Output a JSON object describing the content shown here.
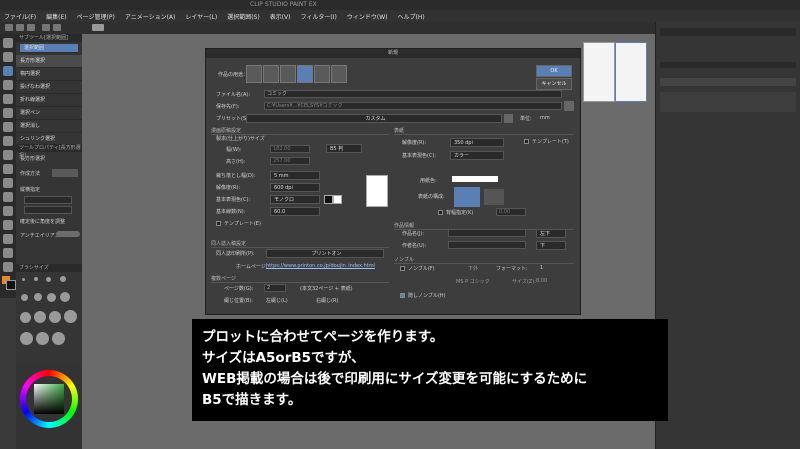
{
  "window": {
    "title": "CLIP STUDIO PAINT EX"
  },
  "menu": [
    "ファイル(F)",
    "編集(E)",
    "ページ管理(P)",
    "アニメーション(A)",
    "レイヤー(L)",
    "選択範囲(S)",
    "表示(V)",
    "フィルター(I)",
    "ウィンドウ(W)",
    "ヘルプ(H)"
  ],
  "subtool": {
    "header": "サブツール[選択範囲]",
    "selected_tab": "選択範囲",
    "items": [
      "長方形選択",
      "楕円選択",
      "投げなわ選択",
      "折れ線選択",
      "選択ペン",
      "選択消し",
      "シュリンク選択"
    ]
  },
  "props": {
    "header": "ツールプロパティ[長方形選択]",
    "label": "長方形選択",
    "mode": "作成方法",
    "fix": "縦横指定",
    "hint": "確定後に角度を調整",
    "aa": "アンチエイリアス"
  },
  "brush": {
    "header": "ブラシサイズ"
  },
  "dialog": {
    "title": "新規",
    "purpose_label": "作品の用途：",
    "ok": "OK",
    "cancel": "キャンセル",
    "filename_label": "ファイル名(A):",
    "filename_value": "コミック",
    "savepath_label": "保存先(F):",
    "savepath_value": "C:¥Users¥...¥CELSYS¥コミック",
    "preset_label": "プリセット(S):",
    "preset_value": "カスタム",
    "unit_label": "単位:",
    "unit_value": "mm",
    "manga_section": "漫画原稿設定",
    "finish_size": "製本(仕上がり)サイズ",
    "width_label": "幅(W):",
    "width_value": "182.00",
    "height_label": "高さ(H):",
    "height_value": "257.00",
    "size_value": "B5 判",
    "bleed_label": "裁ち落とし幅(D):",
    "bleed_value": "5 mm",
    "res_label": "解像度(R):",
    "res_value": "600 dpi",
    "color_label": "基本表現色(C):",
    "color_value": "モノクロ",
    "frame_label": "基本線数(N):",
    "frame_value": "60.0",
    "template_label": "テンプレート(E)",
    "doujin_section": "同人誌入稿設定",
    "doujin_label": "同人誌印刷所(P):",
    "doujin_value": "プリントオン",
    "homepage_label": "ホームページ:",
    "homepage_value": "https://www.printon.co.jp/doujin_index.html",
    "multipage_section": "複数ページ",
    "pages_label": "ページ数(G):",
    "pages_value": "2",
    "pages_note": "(本文32ページ + 表紙)",
    "binding_label": "綴じ位置(B):",
    "binding_left": "左綴じ(L)",
    "binding_right": "右綴じ(R)",
    "cover_section": "表紙",
    "cover_res_label": "解像度(R):",
    "cover_res_value": "350 dpi",
    "cover_color_label": "基本表現色(C):",
    "cover_color_value": "カラー",
    "cover_template": "テンプレート(T)",
    "paper_color_label": "用紙色:",
    "cover_layout_label": "表紙の構成:",
    "spine_label": "背幅指定(K)",
    "spine_value": "0.00",
    "info_section": "作品情報",
    "work_name_label": "作品名(J):",
    "work_name_pos": "左下",
    "author_label": "作者名(U):",
    "author_pos": "下",
    "nombre_section": "ノンブル",
    "nombre_label": "ノンブル(F)",
    "nombre_pos": "下外",
    "font_label": "フォーマット:",
    "start_value": "1",
    "font_value": "MS P ゴシック",
    "size_label": "サイズ(Z):",
    "size_num": "8.00",
    "hidden_nombre": "隠しノンブル(H)"
  },
  "caption": [
    "プロットに合わせてページを作ります。",
    "サイズはA5orB5ですが、",
    "WEB掲載の場合は後で印刷用にサイズ変更を可能にするために",
    "B5で描きます。"
  ],
  "colors": {
    "accent": "#5a7fb5",
    "caption_bg": "#000000",
    "caption_text": "#ffffff"
  }
}
